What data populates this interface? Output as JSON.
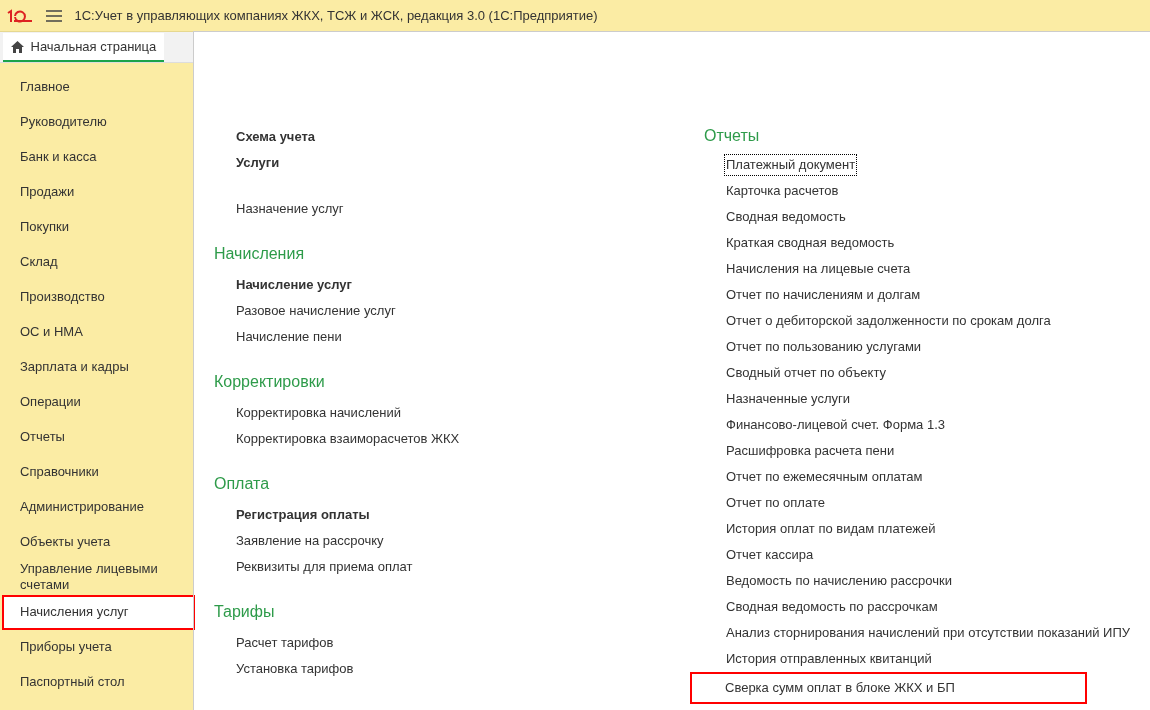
{
  "window": {
    "title": "1С:Учет в управляющих компаниях ЖКХ, ТСЖ и ЖСК, редакция 3.0  (1С:Предприятие)"
  },
  "home_tab": {
    "label": "Начальная страница",
    "selected": true
  },
  "sidebar": {
    "items": [
      {
        "label": "Главное",
        "selected": false,
        "highlighted": false
      },
      {
        "label": "Руководителю",
        "selected": false,
        "highlighted": false
      },
      {
        "label": "Банк и касса",
        "selected": false,
        "highlighted": false
      },
      {
        "label": "Продажи",
        "selected": false,
        "highlighted": false
      },
      {
        "label": "Покупки",
        "selected": false,
        "highlighted": false
      },
      {
        "label": "Склад",
        "selected": false,
        "highlighted": false
      },
      {
        "label": "Производство",
        "selected": false,
        "highlighted": false
      },
      {
        "label": "ОС и НМА",
        "selected": false,
        "highlighted": false
      },
      {
        "label": "Зарплата и кадры",
        "selected": false,
        "highlighted": false
      },
      {
        "label": "Операции",
        "selected": false,
        "highlighted": false
      },
      {
        "label": "Отчеты",
        "selected": false,
        "highlighted": false
      },
      {
        "label": "Справочники",
        "selected": false,
        "highlighted": false
      },
      {
        "label": "Администрирование",
        "selected": false,
        "highlighted": false
      },
      {
        "label": "Объекты учета",
        "selected": false,
        "highlighted": false
      },
      {
        "label": "Управление лицевыми счетами",
        "selected": false,
        "highlighted": false
      },
      {
        "label": "Начисления услуг",
        "selected": true,
        "highlighted": true
      },
      {
        "label": "Приборы учета",
        "selected": false,
        "highlighted": false
      },
      {
        "label": "Паспортный стол",
        "selected": false,
        "highlighted": false
      }
    ]
  },
  "columns": [
    {
      "sections": [
        {
          "items": [
            {
              "label": "Схема учета",
              "bold": true,
              "focused": false,
              "highlighted": false
            },
            {
              "label": "Услуги",
              "bold": true,
              "focused": false,
              "highlighted": false
            }
          ]
        },
        {
          "items": [
            {
              "label": "Назначение услуг",
              "bold": false,
              "focused": false,
              "highlighted": false
            }
          ]
        },
        {
          "title": "Начисления",
          "items": [
            {
              "label": "Начисление услуг",
              "bold": true,
              "focused": false,
              "highlighted": false
            },
            {
              "label": "Разовое начисление услуг",
              "bold": false,
              "focused": false,
              "highlighted": false
            },
            {
              "label": "Начисление пени",
              "bold": false,
              "focused": false,
              "highlighted": false
            }
          ]
        },
        {
          "title": "Корректировки",
          "items": [
            {
              "label": "Корректировка начислений",
              "bold": false,
              "focused": false,
              "highlighted": false
            },
            {
              "label": "Корректировка взаиморасчетов ЖКХ",
              "bold": false,
              "focused": false,
              "highlighted": false
            }
          ]
        },
        {
          "title": "Оплата",
          "items": [
            {
              "label": "Регистрация оплаты",
              "bold": true,
              "focused": false,
              "highlighted": false
            },
            {
              "label": "Заявление на рассрочку",
              "bold": false,
              "focused": false,
              "highlighted": false
            },
            {
              "label": "Реквизиты для приема оплат",
              "bold": false,
              "focused": false,
              "highlighted": false
            }
          ]
        },
        {
          "title": "Тарифы",
          "items": [
            {
              "label": "Расчет тарифов",
              "bold": false,
              "focused": false,
              "highlighted": false
            },
            {
              "label": "Установка тарифов",
              "bold": false,
              "focused": false,
              "highlighted": false
            }
          ]
        }
      ]
    },
    {
      "sections": [
        {
          "title": "Отчеты",
          "items": [
            {
              "label": "Платежный документ",
              "bold": false,
              "focused": true,
              "highlighted": false
            },
            {
              "label": "Карточка расчетов",
              "bold": false,
              "focused": false,
              "highlighted": false
            },
            {
              "label": "Сводная ведомость",
              "bold": false,
              "focused": false,
              "highlighted": false
            },
            {
              "label": "Краткая сводная ведомость",
              "bold": false,
              "focused": false,
              "highlighted": false
            },
            {
              "label": "Начисления на лицевые счета",
              "bold": false,
              "focused": false,
              "highlighted": false
            },
            {
              "label": "Отчет по начислениям и долгам",
              "bold": false,
              "focused": false,
              "highlighted": false
            },
            {
              "label": "Отчет о дебиторской задолженности по срокам долга",
              "bold": false,
              "focused": false,
              "highlighted": false
            },
            {
              "label": "Отчет по пользованию услугами",
              "bold": false,
              "focused": false,
              "highlighted": false
            },
            {
              "label": "Сводный отчет по объекту",
              "bold": false,
              "focused": false,
              "highlighted": false
            },
            {
              "label": "Назначенные услуги",
              "bold": false,
              "focused": false,
              "highlighted": false
            },
            {
              "label": "Финансово-лицевой счет. Форма 1.3",
              "bold": false,
              "focused": false,
              "highlighted": false
            },
            {
              "label": "Расшифровка расчета пени",
              "bold": false,
              "focused": false,
              "highlighted": false
            },
            {
              "label": "Отчет по ежемесячным оплатам",
              "bold": false,
              "focused": false,
              "highlighted": false
            },
            {
              "label": "Отчет по оплате",
              "bold": false,
              "focused": false,
              "highlighted": false
            },
            {
              "label": "История оплат по видам платежей",
              "bold": false,
              "focused": false,
              "highlighted": false
            },
            {
              "label": "Отчет кассира",
              "bold": false,
              "focused": false,
              "highlighted": false
            },
            {
              "label": "Ведомость по начислению рассрочки",
              "bold": false,
              "focused": false,
              "highlighted": false
            },
            {
              "label": "Сводная ведомость по рассрочкам",
              "bold": false,
              "focused": false,
              "highlighted": false
            },
            {
              "label": "Анализ сторнирования начислений при отсутствии показаний ИПУ",
              "bold": false,
              "focused": false,
              "highlighted": false
            },
            {
              "label": "История отправленных квитанций",
              "bold": false,
              "focused": false,
              "highlighted": false
            },
            {
              "label": "Сверка сумм оплат в блоке ЖКХ и БП",
              "bold": false,
              "focused": false,
              "highlighted": true
            }
          ]
        }
      ]
    }
  ]
}
